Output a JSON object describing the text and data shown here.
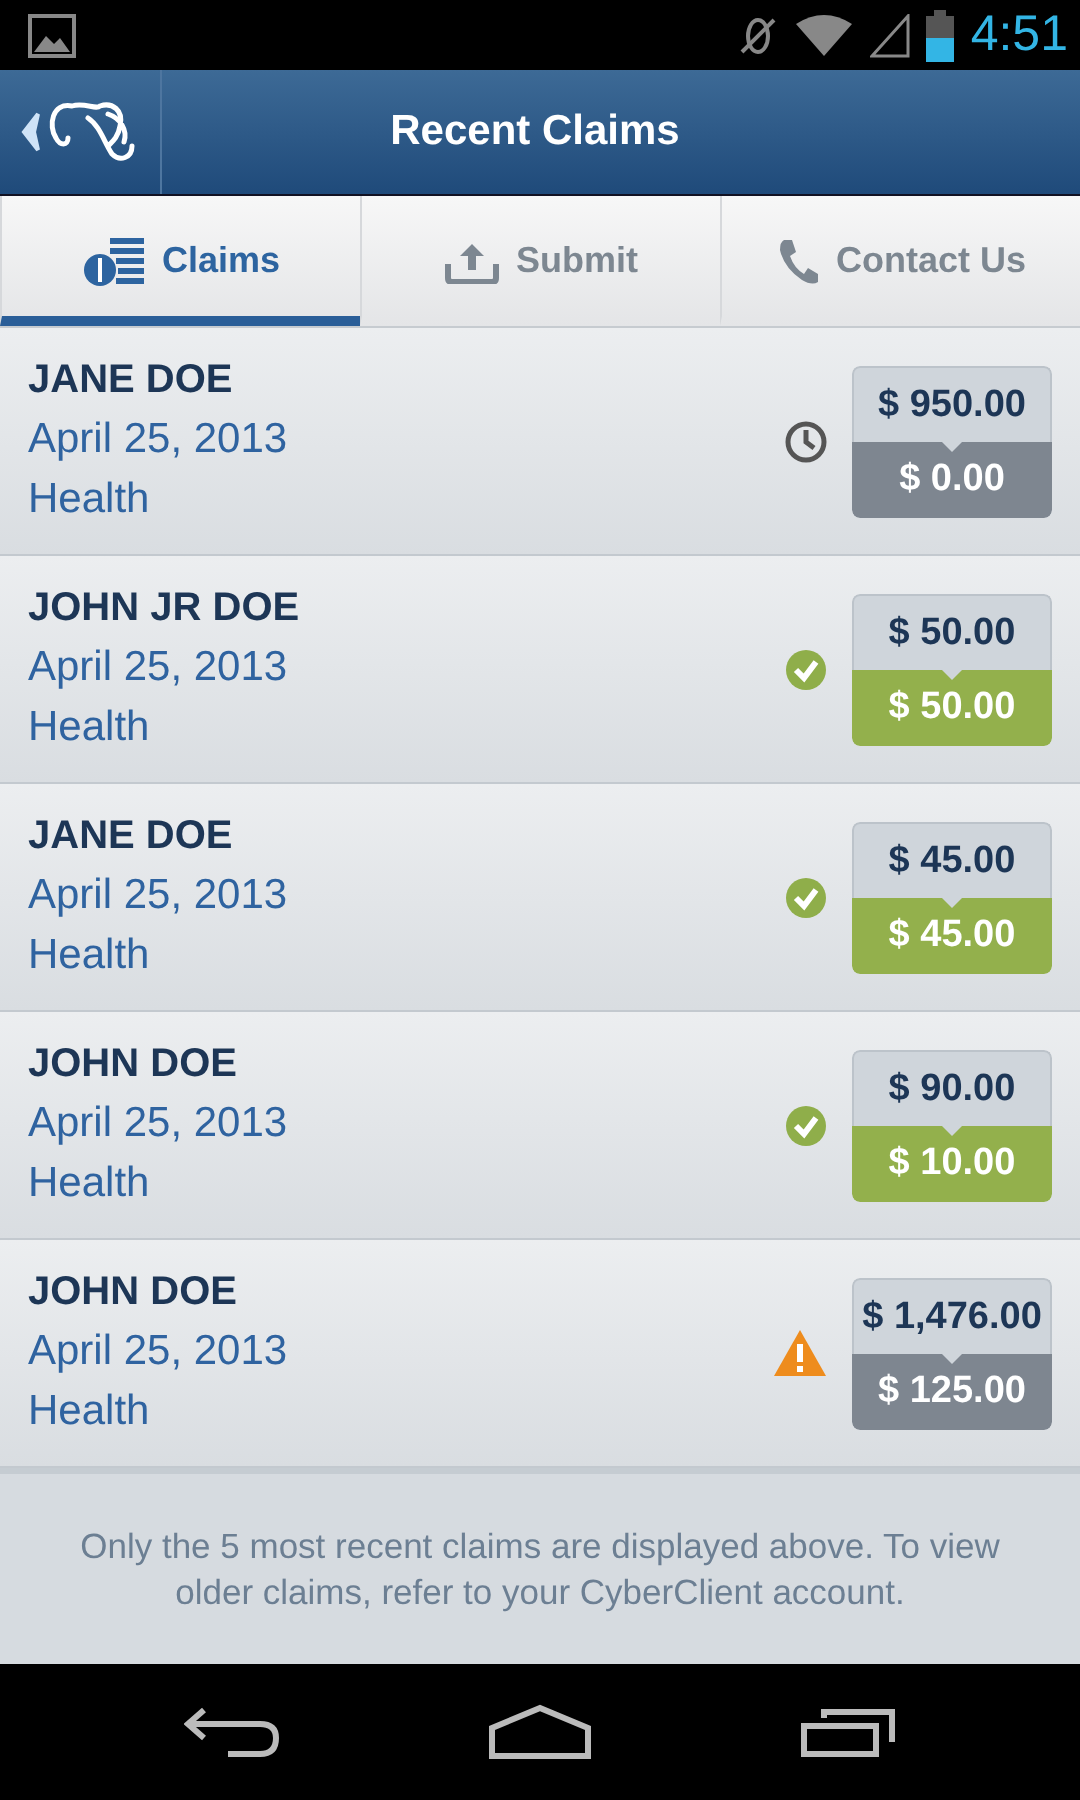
{
  "status_bar": {
    "time": "4:51"
  },
  "header": {
    "title": "Recent Claims"
  },
  "tabs": [
    {
      "label": "Claims",
      "kind": "claims",
      "selected": true
    },
    {
      "label": "Submit",
      "kind": "submit",
      "selected": false
    },
    {
      "label": "Contact Us",
      "kind": "contact",
      "selected": false
    }
  ],
  "claims": [
    {
      "name": "JANE DOE",
      "date": "April 25, 2013",
      "type": "Health",
      "kind": "pending",
      "billed": "$ 950.00",
      "paid": "$ 0.00"
    },
    {
      "name": "JOHN JR DOE",
      "date": "April 25, 2013",
      "type": "Health",
      "kind": "paid",
      "billed": "$ 50.00",
      "paid": "$ 50.00"
    },
    {
      "name": "JANE DOE",
      "date": "April 25, 2013",
      "type": "Health",
      "kind": "paid",
      "billed": "$ 45.00",
      "paid": "$ 45.00"
    },
    {
      "name": "JOHN DOE",
      "date": "April 25, 2013",
      "type": "Health",
      "kind": "paid",
      "billed": "$ 90.00",
      "paid": "$ 10.00"
    },
    {
      "name": "JOHN DOE",
      "date": "April 25, 2013",
      "type": "Health",
      "kind": "alert",
      "billed": "$ 1,476.00",
      "paid": "$ 125.00"
    }
  ],
  "footer_note": "Only the 5 most recent claims are displayed above.  To view older claims, refer to your CyberClient account."
}
